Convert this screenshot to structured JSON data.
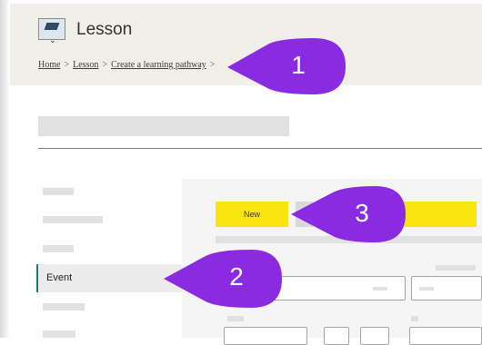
{
  "header": {
    "icon": "graduation-cap-icon",
    "title": "Lesson",
    "breadcrumb": [
      {
        "label": "Home"
      },
      {
        "label": "Lesson"
      },
      {
        "label": "Create a learning pathway"
      }
    ],
    "separator": ">"
  },
  "sidebar": {
    "active_item": "Event"
  },
  "toolbar": {
    "new_label": "New"
  },
  "callouts": [
    "1",
    "2",
    "3"
  ],
  "colors": {
    "accent_yellow": "#f9e50f",
    "callout_purple": "#8a2be2",
    "active_border": "#1d7d6a",
    "header_bg": "#f1f0e8"
  }
}
